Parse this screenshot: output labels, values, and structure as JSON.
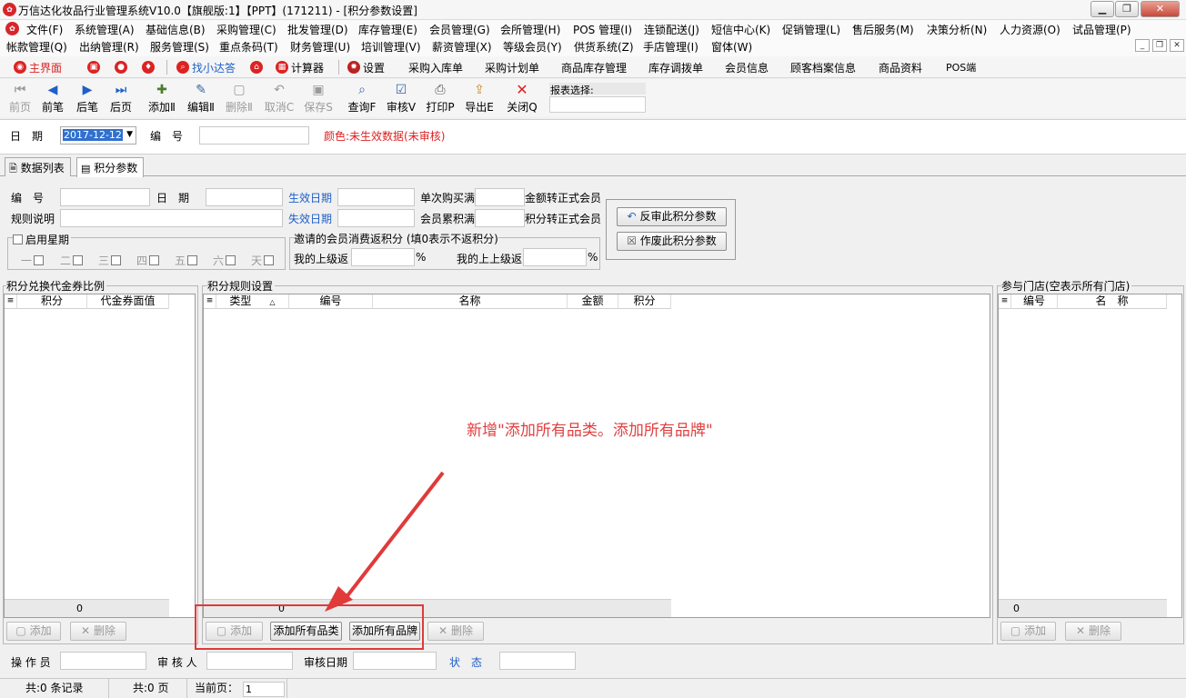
{
  "window": {
    "title": "万信达化妆品行业管理系统V10.0【旗舰版:1】【PPT】(171211) - [积分参数设置]",
    "controls": [
      "▁",
      "❐",
      "✕"
    ]
  },
  "menu_row1": [
    "文件(F)",
    "系统管理(A)",
    "基础信息(B)",
    "采购管理(C)",
    "批发管理(D)",
    "库存管理(E)",
    "会员管理(G)",
    "会所管理(H)",
    "POS 管理(I)",
    "连锁配送(J)",
    "短信中心(K)",
    "促销管理(L)",
    "售后服务(M)",
    "决策分析(N)",
    "人力资源(O)",
    "试品管理(P)"
  ],
  "menu_row2": [
    "帐款管理(Q)",
    "出纳管理(R)",
    "服务管理(S)",
    "重点条码(T)",
    "财务管理(U)",
    "培训管理(V)",
    "薪资管理(X)",
    "等级会员(Y)",
    "供货系统(Z)",
    "手店管理(I)",
    "窗体(W)"
  ],
  "mdi_controls": [
    "_",
    "❐",
    "✕"
  ],
  "quickbar": {
    "home": "主界面",
    "find": "找小达答",
    "calc": "计算器",
    "settings": "设置",
    "links": [
      "采购入库单",
      "采购计划单",
      "商品库存管理",
      "库存调拨单",
      "会员信息",
      "顾客档案信息",
      "商品资料",
      "POS端"
    ]
  },
  "toolbar": [
    {
      "label": "前页",
      "icon": "⏮",
      "enabled": false
    },
    {
      "label": "前笔",
      "icon": "◀",
      "enabled": true
    },
    {
      "label": "后笔",
      "icon": "▶",
      "enabled": true
    },
    {
      "label": "后页",
      "icon": "⏭",
      "enabled": true
    },
    {
      "label": "添加Ⅱ",
      "icon": "✚",
      "enabled": true
    },
    {
      "label": "编辑Ⅱ",
      "icon": "✎",
      "enabled": true
    },
    {
      "label": "删除Ⅱ",
      "icon": "▢",
      "enabled": false
    },
    {
      "label": "取消C",
      "icon": "↶",
      "enabled": false
    },
    {
      "label": "保存S",
      "icon": "▣",
      "enabled": false
    },
    {
      "label": "查询F",
      "icon": "⌕",
      "enabled": true
    },
    {
      "label": "审核V",
      "icon": "☑",
      "enabled": true
    },
    {
      "label": "打印P",
      "icon": "⎙",
      "enabled": true
    },
    {
      "label": "导出E",
      "icon": "⇪",
      "enabled": true
    },
    {
      "label": "关闭Q",
      "icon": "✕",
      "enabled": true
    }
  ],
  "report": {
    "label": "报表选择:"
  },
  "header": {
    "date_label": "日　期",
    "date_value": "2017-12-12",
    "number_label": "编　号",
    "legend": "颜色:未生效数据(未审核)"
  },
  "tabs": [
    "数据列表",
    "积分参数"
  ],
  "form": {
    "number": "编　号",
    "date": "日　期",
    "effective_date": "生效日期",
    "single_purchase": "单次购买满",
    "amount_to_member": "金额转正式会员",
    "rule_desc": "规则说明",
    "expire_date": "失效日期",
    "member_accumulate": "会员累积满",
    "points_to_member": "积分转正式会员",
    "enable_week": "启用星期",
    "weekdays": [
      "一",
      "二",
      "三",
      "四",
      "五",
      "六",
      "天"
    ],
    "invite_title": "邀请的会员消费返积分 (填0表示不返积分)",
    "my_upper": "我的上级返",
    "my_upper2": "我的上上级返",
    "percent": "%",
    "reverse_btn": "反审此积分参数",
    "void_btn": "作废此积分参数"
  },
  "left_panel": {
    "title": "积分兑换代金券比例",
    "columns": [
      "积分",
      "代金券面值"
    ],
    "footer_value": "0",
    "add": "添加",
    "delete": "删除"
  },
  "mid_panel": {
    "title": "积分规则设置",
    "columns": [
      "类型",
      "编号",
      "名称",
      "金额",
      "积分"
    ],
    "footer_value": "0",
    "add": "添加",
    "add_all_categories": "添加所有品类",
    "add_all_brands": "添加所有品牌",
    "delete": "删除"
  },
  "right_panel": {
    "title": "参与门店(空表示所有门店)",
    "columns": [
      "编号",
      "名　称"
    ],
    "footer_value": "0",
    "add": "添加",
    "delete": "删除"
  },
  "annotation": "新增\"添加所有品类。添加所有品牌\"",
  "bottom": {
    "operator": "操 作 员",
    "auditor": "审 核 人",
    "audit_date": "审核日期",
    "status": "状　态"
  },
  "status": {
    "records": "共:0 条记录",
    "pages": "共:0 页",
    "current_label": "当前页：",
    "current_value": "1"
  },
  "colors": {
    "red": "#d22222",
    "blue": "#1f5fc7",
    "annotation": "#e04040"
  }
}
